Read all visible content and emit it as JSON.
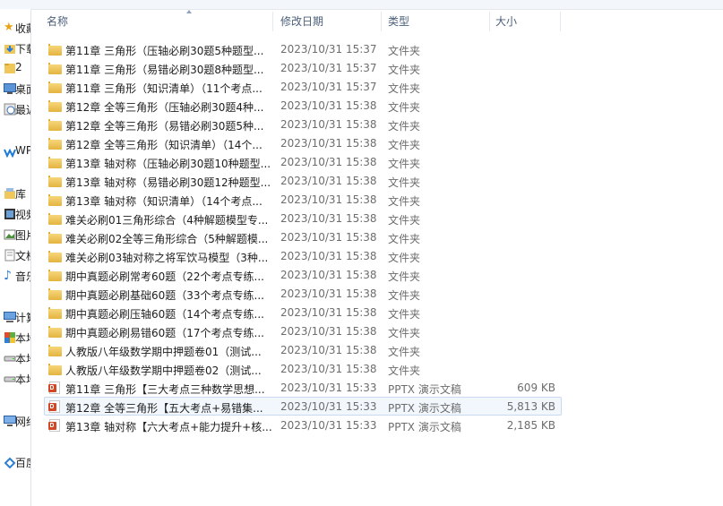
{
  "nav": {
    "items": [
      {
        "label": "收藏夹",
        "icon": "star-icon"
      },
      {
        "label": "下载",
        "icon": "download-folder-icon"
      },
      {
        "label": "2",
        "icon": "folder-icon"
      },
      {
        "label": "桌面",
        "icon": "desktop-icon"
      },
      {
        "label": "最近访问",
        "icon": "recent-places-icon"
      },
      {
        "label": "WPS",
        "icon": "wps-cloud-icon"
      },
      {
        "label": "库",
        "icon": "library-icon"
      },
      {
        "label": "视频",
        "icon": "video-library-icon"
      },
      {
        "label": "图片",
        "icon": "picture-library-icon"
      },
      {
        "label": "文档",
        "icon": "document-library-icon"
      },
      {
        "label": "音乐",
        "icon": "music-library-icon"
      },
      {
        "label": "计算机",
        "icon": "computer-icon"
      },
      {
        "label": "本地磁盘",
        "icon": "system-drive-icon"
      },
      {
        "label": "本地磁盘",
        "icon": "drive-icon"
      },
      {
        "label": "本地磁盘",
        "icon": "drive-icon"
      },
      {
        "label": "网络",
        "icon": "network-icon"
      },
      {
        "label": "百度网盘",
        "icon": "baidu-netdisk-icon"
      }
    ]
  },
  "header": {
    "name": "名称",
    "date": "修改日期",
    "type": "类型",
    "size": "大小"
  },
  "files": [
    {
      "name": "第11章 三角形（压轴必刷30题5种题型...",
      "date": "2023/10/31 15:37",
      "type": "文件夹",
      "size": "",
      "kind": "folder"
    },
    {
      "name": "第11章 三角形（易错必刷30题8种题型...",
      "date": "2023/10/31 15:37",
      "type": "文件夹",
      "size": "",
      "kind": "folder"
    },
    {
      "name": "第11章 三角形（知识清单）（11个考点...",
      "date": "2023/10/31 15:37",
      "type": "文件夹",
      "size": "",
      "kind": "folder"
    },
    {
      "name": "第12章 全等三角形（压轴必刷30题4种...",
      "date": "2023/10/31 15:38",
      "type": "文件夹",
      "size": "",
      "kind": "folder"
    },
    {
      "name": "第12章 全等三角形（易错必刷30题5种...",
      "date": "2023/10/31 15:38",
      "type": "文件夹",
      "size": "",
      "kind": "folder"
    },
    {
      "name": "第12章 全等三角形（知识清单）（14个...",
      "date": "2023/10/31 15:38",
      "type": "文件夹",
      "size": "",
      "kind": "folder"
    },
    {
      "name": "第13章 轴对称（压轴必刷30题10种题型...",
      "date": "2023/10/31 15:38",
      "type": "文件夹",
      "size": "",
      "kind": "folder"
    },
    {
      "name": "第13章 轴对称（易错必刷30题12种题型...",
      "date": "2023/10/31 15:38",
      "type": "文件夹",
      "size": "",
      "kind": "folder"
    },
    {
      "name": "第13章 轴对称（知识清单）（14个考点...",
      "date": "2023/10/31 15:38",
      "type": "文件夹",
      "size": "",
      "kind": "folder"
    },
    {
      "name": "难关必刷01三角形综合（4种解题模型专...",
      "date": "2023/10/31 15:38",
      "type": "文件夹",
      "size": "",
      "kind": "folder"
    },
    {
      "name": "难关必刷02全等三角形综合（5种解题模...",
      "date": "2023/10/31 15:38",
      "type": "文件夹",
      "size": "",
      "kind": "folder"
    },
    {
      "name": "难关必刷03轴对称之将军饮马模型（3种...",
      "date": "2023/10/31 15:38",
      "type": "文件夹",
      "size": "",
      "kind": "folder"
    },
    {
      "name": "期中真题必刷常考60题（22个考点专练...",
      "date": "2023/10/31 15:38",
      "type": "文件夹",
      "size": "",
      "kind": "folder"
    },
    {
      "name": "期中真题必刷基础60题（33个考点专练...",
      "date": "2023/10/31 15:38",
      "type": "文件夹",
      "size": "",
      "kind": "folder"
    },
    {
      "name": "期中真题必刷压轴60题（14个考点专练...",
      "date": "2023/10/31 15:38",
      "type": "文件夹",
      "size": "",
      "kind": "folder"
    },
    {
      "name": "期中真题必刷易错60题（17个考点专练...",
      "date": "2023/10/31 15:38",
      "type": "文件夹",
      "size": "",
      "kind": "folder"
    },
    {
      "name": "人教版八年级数学期中押题卷01（测试...",
      "date": "2023/10/31 15:38",
      "type": "文件夹",
      "size": "",
      "kind": "folder"
    },
    {
      "name": "人教版八年级数学期中押题卷02（测试...",
      "date": "2023/10/31 15:38",
      "type": "文件夹",
      "size": "",
      "kind": "folder"
    },
    {
      "name": "第11章 三角形【三大考点三种数学思想...",
      "date": "2023/10/31 15:33",
      "type": "PPTX 演示文稿",
      "size": "609 KB",
      "kind": "pptx"
    },
    {
      "name": "第12章 全等三角形【五大考点+易错集...",
      "date": "2023/10/31 15:33",
      "type": "PPTX 演示文稿",
      "size": "5,813 KB",
      "kind": "pptx",
      "selected": true
    },
    {
      "name": "第13章 轴对称【六大考点+能力提升+核...",
      "date": "2023/10/31 15:33",
      "type": "PPTX 演示文稿",
      "size": "2,185 KB",
      "kind": "pptx"
    }
  ]
}
